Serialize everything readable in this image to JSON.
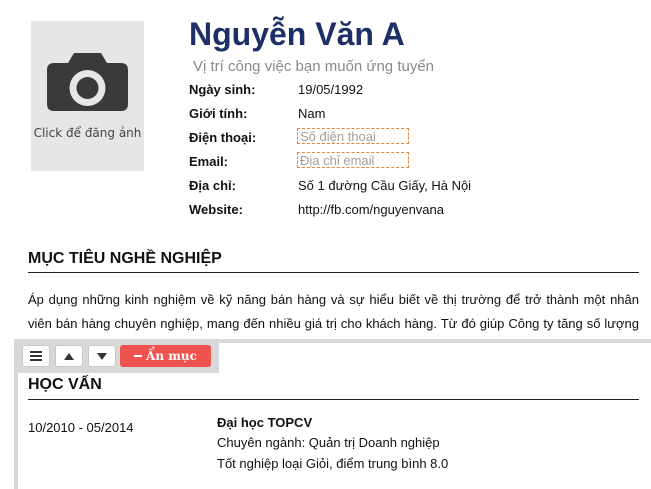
{
  "photo": {
    "label": "Click để đăng ảnh",
    "icon": "camera-icon"
  },
  "header": {
    "name": "Nguyễn Văn A",
    "position_placeholder": "Vị trí công việc bạn muốn ứng tuyển"
  },
  "info": {
    "birth_label": "Ngày sinh:",
    "birth_value": "19/05/1992",
    "gender_label": "Giới tính:",
    "gender_value": "Nam",
    "phone_label": "Điện thoại:",
    "phone_placeholder": "Số điện thoại",
    "email_label": "Email:",
    "email_placeholder": "Địa chỉ email",
    "address_label": "Địa chỉ:",
    "address_value": "Số 1 đường Cầu Giấy, Hà Nội",
    "website_label": "Website:",
    "website_value": "http://fb.com/nguyenvana"
  },
  "objective": {
    "title": "MỤC TIÊU NGHỀ NGHIỆP",
    "text": "Áp dụng những kinh nghiệm về kỹ năng bán hàng và sự hiểu biết về thị trường để trở thành một nhân viên bán hàng chuyên nghiệp, mang đến nhiều giá trị cho khách hàng. Từ đó giúp Công ty tăng số lượng khách hàng và mở rộng tập khách hàng."
  },
  "toolbar": {
    "menu_icon": "menu-icon",
    "up_icon": "arrow-up-icon",
    "down_icon": "arrow-down-icon",
    "hide_label": "Ẩn mục",
    "hide_icon": "minus-icon"
  },
  "education": {
    "title": "HỌC VẤN",
    "time": "10/2010 - 05/2014",
    "school": "Đại học TOPCV",
    "major": "Chuyên ngành: Quản trị Doanh nghiệp",
    "result": "Tốt nghiệp loại Giỏi, điểm trung bình 8.0"
  },
  "colors": {
    "name": "#1d2f66",
    "input_border": "#e8833a",
    "hide_button": "#ef5350",
    "panel": "#d8d8d8"
  }
}
